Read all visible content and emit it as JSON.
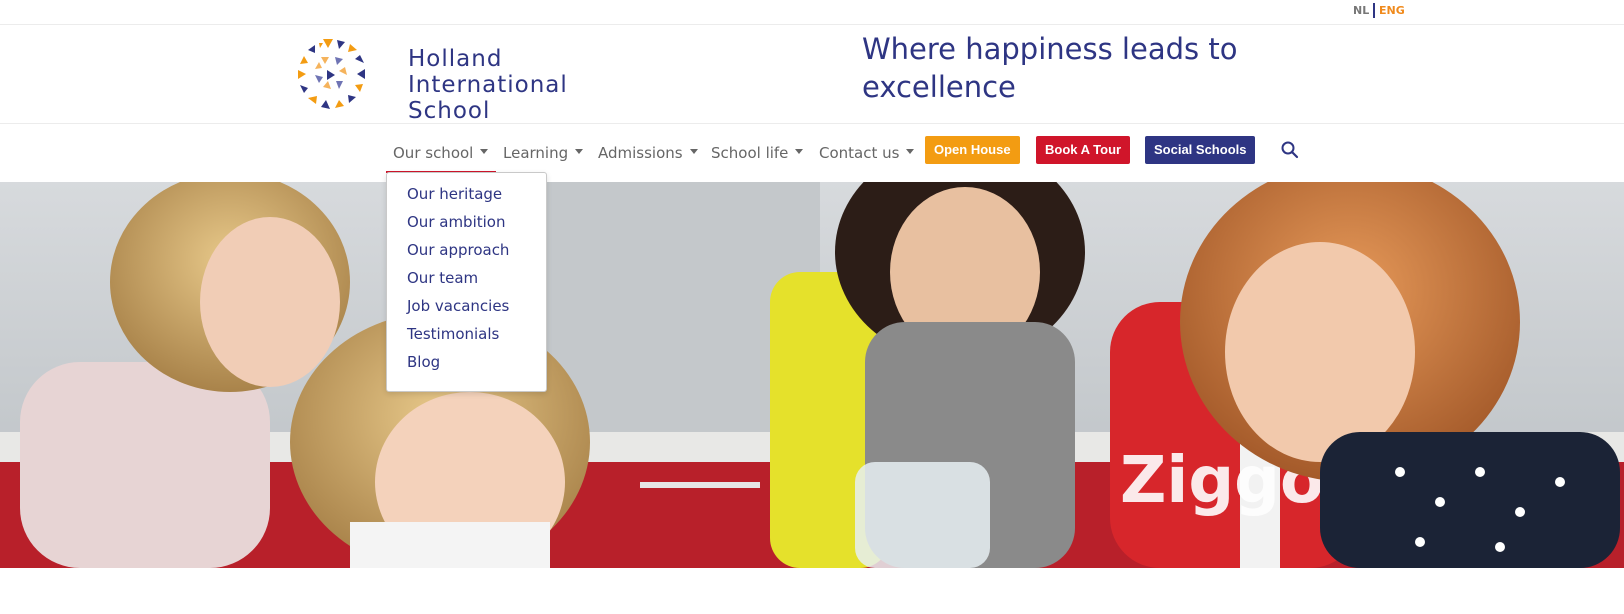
{
  "language": {
    "nl": "NL",
    "eng": "ENG"
  },
  "logo": {
    "line1": "Holland",
    "line2": "International",
    "line3": "School"
  },
  "tagline": "Where happiness leads to excellence",
  "nav": {
    "items": [
      {
        "label": "Our school"
      },
      {
        "label": "Learning"
      },
      {
        "label": "Admissions"
      },
      {
        "label": "School life"
      },
      {
        "label": "Contact us"
      }
    ],
    "buttons": {
      "open_house": "Open House",
      "book_tour": "Book A Tour",
      "social_schools": "Social Schools"
    },
    "search_icon": "search-icon"
  },
  "dropdown": {
    "items": [
      "Our heritage",
      "Our ambition",
      "Our approach",
      "Our team",
      "Job vacancies",
      "Testimonials",
      "Blog"
    ]
  },
  "colors": {
    "brand_blue": "#2e3583",
    "brand_orange": "#f39c12",
    "brand_red": "#d0152a"
  }
}
